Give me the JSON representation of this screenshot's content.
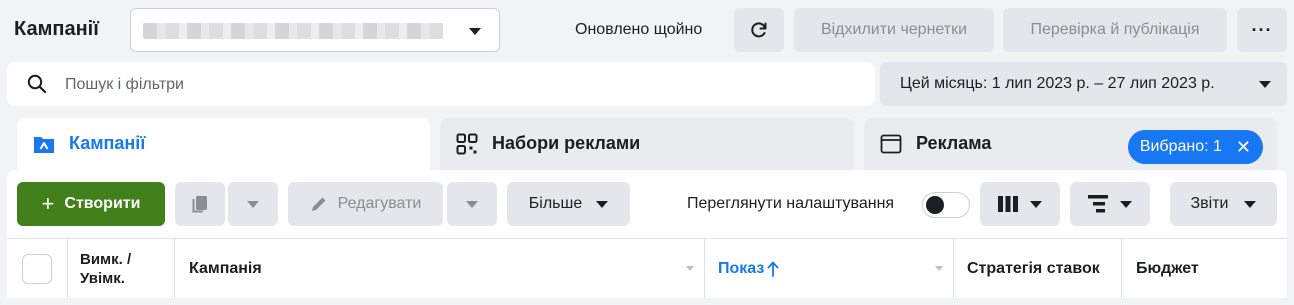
{
  "header": {
    "title": "Кампанії",
    "updated_text": "Оновлено щойно",
    "discard_label": "Відхилити чернетки",
    "publish_label": "Перевірка й публікація",
    "more_label": "···"
  },
  "search": {
    "placeholder": "Пошук і фільтри",
    "date_range": "Цей місяць: 1 лип 2023 р. – 27 лип 2023 р."
  },
  "level_tabs": [
    {
      "label": "Кампанії",
      "icon": "folder-icon",
      "active": true
    },
    {
      "label": "Набори реклами",
      "icon": "grid-icon",
      "active": false
    },
    {
      "label": "Реклама",
      "icon": "window-icon",
      "active": false
    }
  ],
  "selected_chip": "Вибрано: 1",
  "toolbar": {
    "create_label": "Створити",
    "edit_label": "Редагувати",
    "more_label": "Більше",
    "review_settings_label": "Переглянути налаштування",
    "reports_label": "Звіти"
  },
  "table": {
    "columns": [
      {
        "label": "Вимк. / Увімк.",
        "line1": "Вимк. /",
        "line2": "Увімк."
      },
      {
        "label": "Кампанія"
      },
      {
        "label": "Показ",
        "sorted": "ascending"
      },
      {
        "label": "Стратегія ставок"
      },
      {
        "label": "Бюджет"
      }
    ]
  },
  "colors": {
    "accent": "#1877f2",
    "create_green": "#42801c",
    "background": "#f2f3f5"
  }
}
